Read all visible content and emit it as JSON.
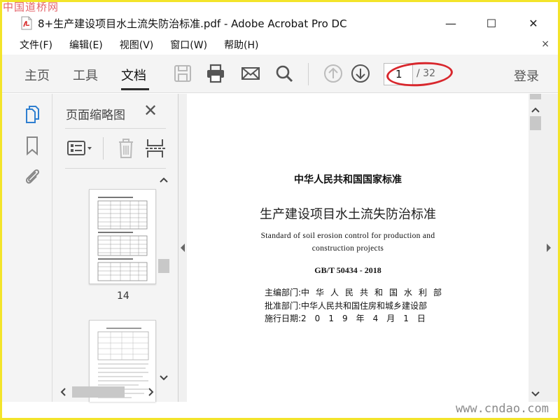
{
  "watermark": {
    "top_left": "中国道桥网",
    "bottom_right": "www.cndao.com"
  },
  "window": {
    "title": "8+生产建设项目水土流失防治标准.pdf - Adobe Acrobat Pro DC",
    "min_glyph": "—",
    "max_glyph": "☐",
    "close_glyph": "✕"
  },
  "menu": {
    "items": [
      "文件(F)",
      "编辑(E)",
      "视图(V)",
      "窗口(W)",
      "帮助(H)"
    ],
    "close_glyph": "×"
  },
  "toolbar": {
    "tabs": [
      "主页",
      "工具",
      "文档"
    ],
    "active_tab": "文档",
    "page_current": "1",
    "page_total": "/ 32",
    "login": "登录"
  },
  "thumbnail_panel": {
    "title": "页面缩略图",
    "close_glyph": "✕",
    "pages": [
      {
        "label": "14"
      }
    ]
  },
  "document": {
    "heading": "中华人民共和国国家标准",
    "title": "生产建设项目水土流失防治标准",
    "english_line1": "Standard of soil erosion control for production and",
    "english_line2": "construction projects",
    "code": "GB/T 50434 - 2018",
    "meta": [
      {
        "label": "主编部门:",
        "value": "中华人民共和国水利部"
      },
      {
        "label": "批准部门:",
        "value": "中华人民共和国住房和城乡建设部"
      },
      {
        "label": "施行日期:",
        "value": "2019年4月1日"
      }
    ]
  },
  "colors": {
    "frame": "#f3e42a",
    "annotation_oval": "#d8272d",
    "toolbar_bg": "#f4f4f4",
    "pdf_icon_red": "#d72c2c"
  },
  "icons": [
    "pdf-file-icon",
    "save-icon",
    "print-icon",
    "email-icon",
    "search-icon",
    "prev-page-icon",
    "next-page-icon",
    "pages-icon",
    "bookmark-icon",
    "attachment-icon",
    "options-icon",
    "trash-icon",
    "extract-icon"
  ]
}
